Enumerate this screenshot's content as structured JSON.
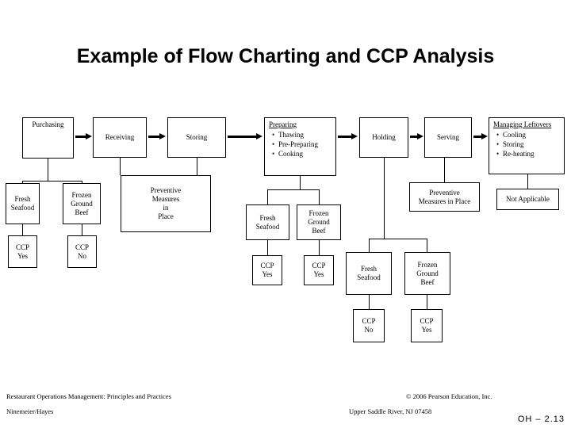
{
  "slide": {
    "title": "Example of Flow Charting and CCP Analysis",
    "number": "OH – 2.13"
  },
  "process_steps": {
    "purchasing": "Purchasing",
    "receiving": "Receiving",
    "storing": "Storing",
    "preparing_header": "Preparing",
    "preparing_items": [
      "Thawing",
      "Pre-Preparing",
      "Cooking"
    ],
    "holding": "Holding",
    "serving": "Serving",
    "leftovers_header": "Managing Leftovers",
    "leftovers_items": [
      "Cooling",
      "Storing",
      "Re-heating"
    ]
  },
  "analysis": {
    "purchasing_fresh_seafood": "Fresh\nSeafood",
    "purchasing_frozen_beef": "Frozen\nGround\nBeef",
    "purchasing_fresh_seafood_ccp": "CCP\nYes",
    "purchasing_frozen_beef_ccp": "CCP\nNo",
    "storing_preventive": "Preventive\nMeasures\nin\nPlace",
    "preparing_fresh_seafood": "Fresh\nSeafood",
    "preparing_frozen_beef": "Frozen\nGround\nBeef",
    "preparing_fresh_seafood_ccp": "CCP\nYes",
    "preparing_frozen_beef_ccp": "CCP\nYes",
    "holding_fresh_seafood": "Fresh\nSeafood",
    "holding_frozen_beef": "Frozen\nGround\nBeef",
    "holding_fresh_seafood_ccp": "CCP\nNo",
    "holding_frozen_beef_ccp": "CCP\nYes",
    "serving_preventive": "Preventive\nMeasures in Place",
    "leftovers_not_applicable": "Not Applicable"
  },
  "footer": {
    "book_title": "Restaurant Operations Management: Principles and Practices",
    "authors": "Ninemeier/Hayes",
    "copyright": "© 2006 Pearson Education, Inc.",
    "publisher_location": "Upper Saddle River, NJ 07458"
  },
  "colors": {
    "background": "#ffffff",
    "line": "#000000",
    "text": "#000000"
  }
}
